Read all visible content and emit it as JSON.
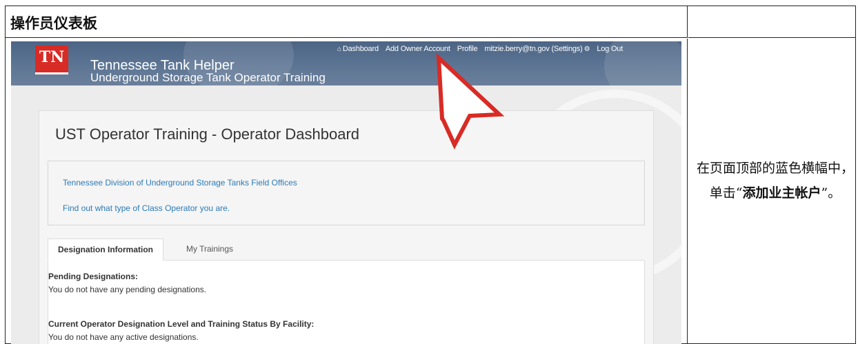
{
  "document": {
    "title": "操作员仪表板",
    "instruction_before": "在页面顶部的蓝色横幅中，单击“",
    "instruction_bold": "添加业主帐户",
    "instruction_after": "”。"
  },
  "site": {
    "logo_text": "TN",
    "title": "Tennessee Tank Helper",
    "subtitle": "Underground Storage Tank Operator Training"
  },
  "nav": {
    "dashboard": "Dashboard",
    "dashboard_icon": "home-icon",
    "add_owner": "Add Owner Account",
    "profile": "Profile",
    "settings": "mitzie.berry@tn.gov (Settings)",
    "settings_icon": "gear-icon",
    "logout": "Log Out"
  },
  "main": {
    "title": "UST Operator Training - Operator Dashboard",
    "link_field_offices": "Tennessee Division of Underground Storage Tanks Field Offices",
    "link_class_operator": "Find out what type of Class Operator you are.",
    "tabs": [
      {
        "label": "Designation Information",
        "active": true
      },
      {
        "label": "My Trainings",
        "active": false
      }
    ],
    "pending_heading": "Pending Designations:",
    "pending_text": "You do not have any pending designations.",
    "current_heading": "Current Operator Designation Level and Training Status By Facility:",
    "current_text": "You do not have any active designations."
  },
  "colors": {
    "banner": "#5d7594",
    "logo_red": "#d82b25",
    "link": "#2a7ab8",
    "arrow": "#d82b25"
  }
}
